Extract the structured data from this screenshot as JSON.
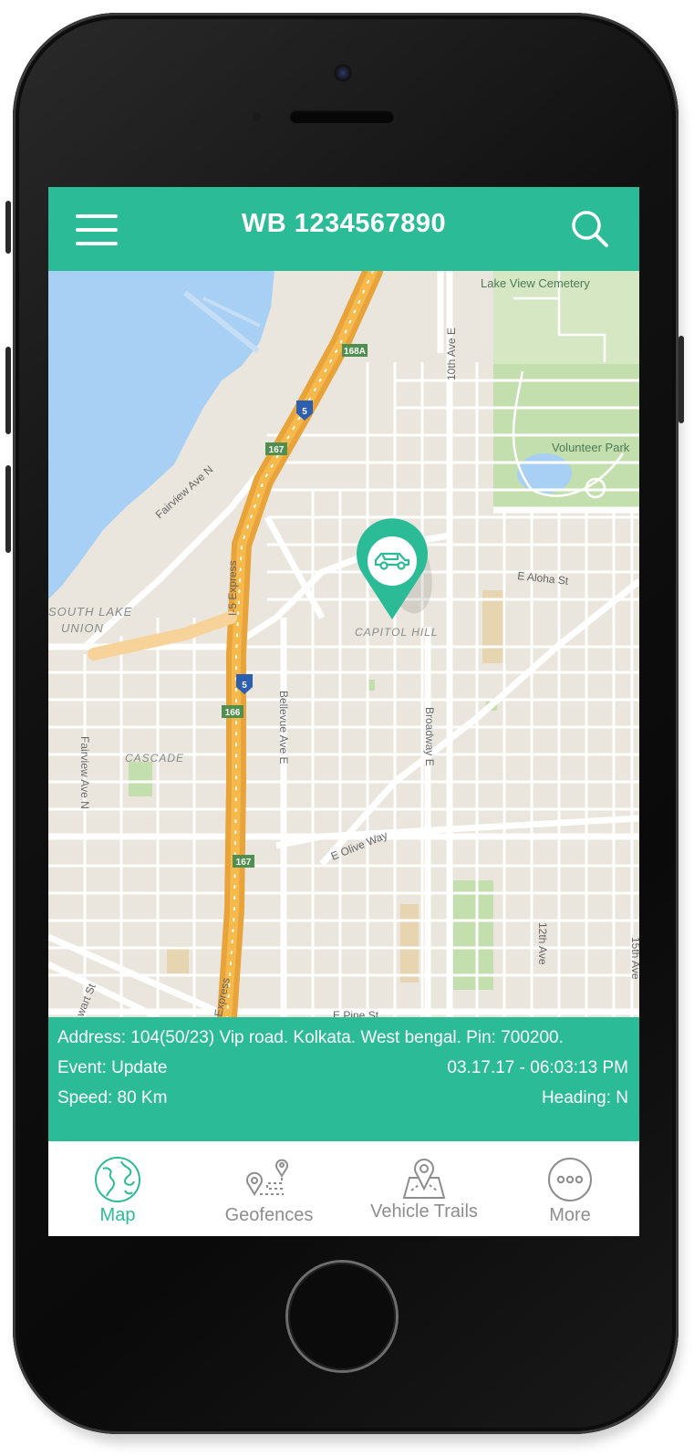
{
  "header": {
    "title": "WB 1234567890"
  },
  "map": {
    "labels": {
      "lake_view": "Lake View Cemetery",
      "volunteer_park": "Volunteer Park",
      "fairview_ave_n": "Fairview Ave N",
      "fairview_ave_n_2": "Fairview Ave N",
      "south_lake_union_1": "SOUTH LAKE",
      "south_lake_union_2": "UNION",
      "i5_express": "I-5 Express",
      "express_bottom": "Express",
      "capitol_hill": "CAPITOL HILL",
      "e_aloha": "E Aloha St",
      "tenth_ave_e": "10th Ave E",
      "bellevue_ave_e": "Bellevue Ave E",
      "broadway_e": "Broadway E",
      "cascade": "CASCADE",
      "e_olive_way": "E Olive Way",
      "twelfth_ave": "12th Ave",
      "fifteenth_ave": "15th Ave",
      "e_pine_st": "E Pine St",
      "stewart_st": "wart St",
      "shield_168a": "168A",
      "shield_167_top": "167",
      "shield_166": "166",
      "shield_167_bottom": "167",
      "shield_5_top": "5",
      "shield_5_bottom": "5"
    }
  },
  "info": {
    "address": "Address: 104(50/23) Vip road. Kolkata. West bengal. Pin: 700200.",
    "event": "Event: Update",
    "datetime": "03.17.17 - 06:03:13 PM",
    "speed": "Speed: 80 Km",
    "heading": "Heading: N"
  },
  "tabs": [
    {
      "label": "Map",
      "icon": "globe-icon",
      "active": true
    },
    {
      "label": "Geofences",
      "icon": "geofence-icon",
      "active": false
    },
    {
      "label": "Vehicle Trails",
      "icon": "map-pin-icon",
      "active": false
    },
    {
      "label": "More",
      "icon": "more-icon",
      "active": false
    }
  ],
  "colors": {
    "accent": "#2cbb97",
    "map_bg": "#ebe6dd",
    "water": "#a8d0f5",
    "park": "#c4dfae",
    "highway": "#f39c12",
    "inactive": "#8d8d8d"
  }
}
